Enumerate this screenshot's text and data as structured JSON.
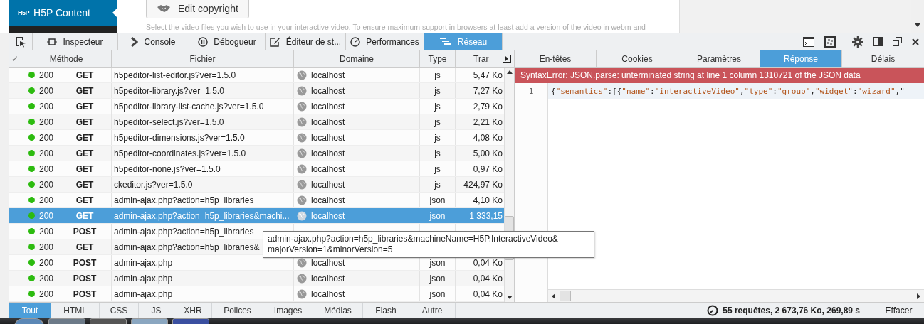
{
  "page": {
    "sidebar_title": "H5P Content",
    "logo": "H5P",
    "edit_button": "Edit copyright",
    "hint": "Select the video files you wish to use in your interactive video. To ensure maximum support in browsers at least add a version of the video in webm and"
  },
  "devtools_tabs": [
    {
      "label": "Inspecteur",
      "kind": "inspector",
      "selected": false
    },
    {
      "label": "Console",
      "kind": "console",
      "selected": false
    },
    {
      "label": "Débogueur",
      "kind": "debugger",
      "selected": false
    },
    {
      "label": "Éditeur de st...",
      "kind": "style",
      "selected": false
    },
    {
      "label": "Performances",
      "kind": "perf",
      "selected": false
    },
    {
      "label": "Réseau",
      "kind": "network",
      "selected": true
    }
  ],
  "table": {
    "columns": [
      "✓",
      "Méthode",
      "Fichier",
      "Domaine",
      "Type",
      "Trar"
    ],
    "rows": [
      {
        "status": "200",
        "method": "GET",
        "file": "h5peditor-list-editor.js?ver=1.5.0",
        "domain": "localhost",
        "type": "js",
        "size": "5,47 Ko",
        "selected": false
      },
      {
        "status": "200",
        "method": "GET",
        "file": "h5peditor-library.js?ver=1.5.0",
        "domain": "localhost",
        "type": "js",
        "size": "7,27 Ko",
        "selected": false
      },
      {
        "status": "200",
        "method": "GET",
        "file": "h5peditor-library-list-cache.js?ver=1.5.0",
        "domain": "localhost",
        "type": "js",
        "size": "2,79 Ko",
        "selected": false
      },
      {
        "status": "200",
        "method": "GET",
        "file": "h5peditor-select.js?ver=1.5.0",
        "domain": "localhost",
        "type": "js",
        "size": "2,21 Ko",
        "selected": false
      },
      {
        "status": "200",
        "method": "GET",
        "file": "h5peditor-dimensions.js?ver=1.5.0",
        "domain": "localhost",
        "type": "js",
        "size": "4,08 Ko",
        "selected": false
      },
      {
        "status": "200",
        "method": "GET",
        "file": "h5peditor-coordinates.js?ver=1.5.0",
        "domain": "localhost",
        "type": "js",
        "size": "5,00 Ko",
        "selected": false
      },
      {
        "status": "200",
        "method": "GET",
        "file": "h5peditor-none.js?ver=1.5.0",
        "domain": "localhost",
        "type": "js",
        "size": "0,97 Ko",
        "selected": false
      },
      {
        "status": "200",
        "method": "GET",
        "file": "ckeditor.js?ver=1.5.0",
        "domain": "localhost",
        "type": "js",
        "size": "424,97 Ko",
        "selected": false
      },
      {
        "status": "200",
        "method": "GET",
        "file": "admin-ajax.php?action=h5p_libraries",
        "domain": "localhost",
        "type": "json",
        "size": "4,10 Ko",
        "selected": false
      },
      {
        "status": "200",
        "method": "GET",
        "file": "admin-ajax.php?action=h5p_libraries&machi...",
        "domain": "localhost",
        "type": "json",
        "size": "1 333,15",
        "selected": true
      },
      {
        "status": "200",
        "method": "POST",
        "file": "admin-ajax.php?action=h5p_libraries",
        "selected": false
      },
      {
        "status": "200",
        "method": "GET",
        "file": "admin-ajax.php?action=h5p_libraries&",
        "selected": false
      },
      {
        "status": "200",
        "method": "POST",
        "file": "admin-ajax.php",
        "domain": "localhost",
        "type": "json",
        "size": "0,04 Ko",
        "selected": false
      },
      {
        "status": "200",
        "method": "POST",
        "file": "admin-ajax.php",
        "domain": "localhost",
        "type": "json",
        "size": "0,04 Ko",
        "selected": false
      },
      {
        "status": "200",
        "method": "POST",
        "file": "admin-ajax.php",
        "domain": "localhost",
        "type": "json",
        "size": "0,04 Ko",
        "selected": false
      }
    ]
  },
  "tooltip": [
    "admin-ajax.php?action=h5p_libraries&machineName=H5P.InteractiveVideo&",
    "majorVersion=1&minorVersion=5"
  ],
  "detail_tabs": [
    {
      "label": "En-têtes",
      "selected": false
    },
    {
      "label": "Cookies",
      "selected": false
    },
    {
      "label": "Paramètres",
      "selected": false
    },
    {
      "label": "Réponse",
      "selected": true
    },
    {
      "label": "Délais",
      "selected": false
    }
  ],
  "error": "SyntaxError: JSON.parse: unterminated string at line 1 column 1310721 of the JSON data",
  "code": {
    "line_number": "1",
    "tokens": [
      {
        "text": "{",
        "kind": "punct"
      },
      {
        "text": "\"semantics\"",
        "kind": "string"
      },
      {
        "text": ":[{",
        "kind": "punct"
      },
      {
        "text": "\"name\"",
        "kind": "string"
      },
      {
        "text": ":",
        "kind": "punct"
      },
      {
        "text": "\"interactiveVideo\"",
        "kind": "string"
      },
      {
        "text": ",",
        "kind": "punct"
      },
      {
        "text": "\"type\"",
        "kind": "string"
      },
      {
        "text": ":",
        "kind": "punct"
      },
      {
        "text": "\"group\"",
        "kind": "string"
      },
      {
        "text": ",",
        "kind": "punct"
      },
      {
        "text": "\"widget\"",
        "kind": "string"
      },
      {
        "text": ":",
        "kind": "punct"
      },
      {
        "text": "\"wizard\"",
        "kind": "string"
      },
      {
        "text": ",\"",
        "kind": "punct"
      }
    ]
  },
  "filters": [
    {
      "label": "Tout",
      "selected": true
    },
    {
      "label": "HTML",
      "selected": false
    },
    {
      "label": "CSS",
      "selected": false
    },
    {
      "label": "JS",
      "selected": false
    },
    {
      "label": "XHR",
      "selected": false
    },
    {
      "label": "Polices",
      "selected": false
    },
    {
      "label": "Images",
      "selected": false
    },
    {
      "label": "Médias",
      "selected": false
    },
    {
      "label": "Flash",
      "selected": false
    },
    {
      "label": "Autre",
      "selected": false
    }
  ],
  "summary": "55 requêtes, 2 673,76 Ko, 269,89 s",
  "clear_button": "Effacer"
}
